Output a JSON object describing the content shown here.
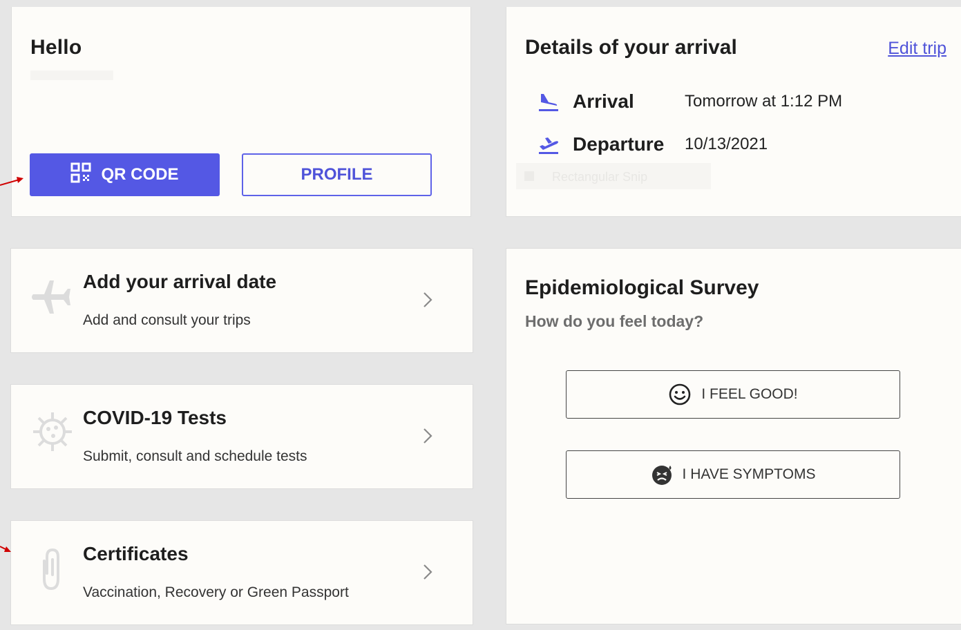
{
  "hello_card": {
    "greeting": "Hello",
    "qr_button_label": "QR CODE",
    "profile_button_label": "PROFILE"
  },
  "arrival_card": {
    "title": "Details of your arrival",
    "edit_link": "Edit trip",
    "rows": [
      {
        "label": "Arrival",
        "value": "Tomorrow at 1:12 PM",
        "icon": "plane-landing-icon"
      },
      {
        "label": "Departure",
        "value": "10/13/2021",
        "icon": "plane-takeoff-icon"
      }
    ],
    "ghost_overlay_text": "Rectangular Snip"
  },
  "nav_cards": [
    {
      "title": "Add your arrival date",
      "subtitle": "Add and consult your trips",
      "icon": "airplane-icon"
    },
    {
      "title": "COVID-19 Tests",
      "subtitle": "Submit, consult and schedule tests",
      "icon": "virus-icon"
    },
    {
      "title": "Certificates",
      "subtitle": "Vaccination, Recovery or Green Passport",
      "icon": "paperclip-icon"
    }
  ],
  "survey": {
    "title": "Epidemiological Survey",
    "subtitle": "How do you feel today?",
    "good_button": "I FEEL GOOD!",
    "symptoms_button": "I HAVE SYMPTOMS"
  },
  "colors": {
    "accent": "#5458e4",
    "card_bg": "#fdfcf9",
    "page_bg": "#e6e6e6",
    "annotation_arrow": "#d00000"
  }
}
